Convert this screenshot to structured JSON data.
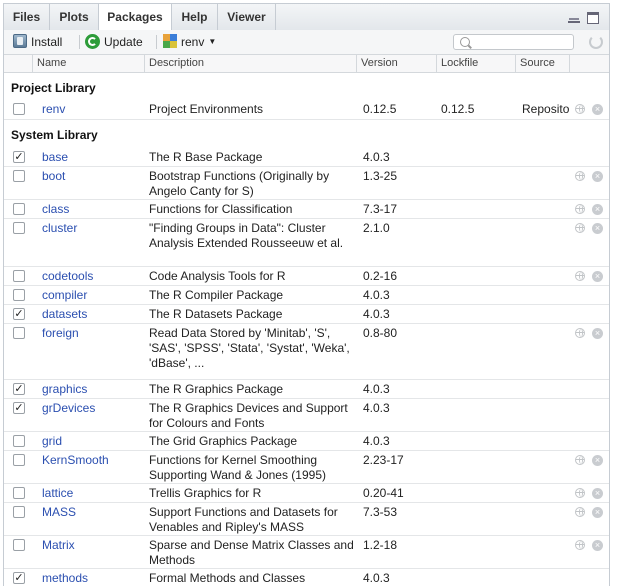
{
  "tabs": [
    "Files",
    "Plots",
    "Packages",
    "Help",
    "Viewer"
  ],
  "toolbar": {
    "install": "Install",
    "update": "Update",
    "renv": "renv",
    "search_placeholder": ""
  },
  "columns": [
    "Name",
    "Description",
    "Version",
    "Lockfile",
    "Source"
  ],
  "sections": {
    "project": "Project Library",
    "system": "System Library"
  },
  "project_packages": [
    {
      "name": "renv",
      "desc": "Project Environments",
      "version": "0.12.5",
      "lockfile": "0.12.5",
      "source": "Repository",
      "checked": false,
      "links": true
    }
  ],
  "system_packages": [
    {
      "name": "base",
      "desc": "The R Base Package",
      "version": "4.0.3",
      "checked": true,
      "links": false
    },
    {
      "name": "boot",
      "desc": "Bootstrap Functions (Originally by Angelo Canty for S)",
      "version": "1.3-25",
      "checked": false,
      "links": true
    },
    {
      "name": "class",
      "desc": "Functions for Classification",
      "version": "7.3-17",
      "checked": false,
      "links": true
    },
    {
      "name": "cluster",
      "desc": "\"Finding Groups in Data\": Cluster Analysis Extended Rousseeuw et al.",
      "version": "2.1.0",
      "checked": false,
      "links": true
    },
    {
      "name": "codetools",
      "desc": "Code Analysis Tools for R",
      "version": "0.2-16",
      "checked": false,
      "links": true
    },
    {
      "name": "compiler",
      "desc": "The R Compiler Package",
      "version": "4.0.3",
      "checked": false,
      "links": false
    },
    {
      "name": "datasets",
      "desc": "The R Datasets Package",
      "version": "4.0.3",
      "checked": true,
      "links": false
    },
    {
      "name": "foreign",
      "desc": "Read Data Stored by 'Minitab', 'S', 'SAS', 'SPSS', 'Stata', 'Systat', 'Weka', 'dBase', ...",
      "version": "0.8-80",
      "checked": false,
      "links": true
    },
    {
      "name": "graphics",
      "desc": "The R Graphics Package",
      "version": "4.0.3",
      "checked": true,
      "links": false
    },
    {
      "name": "grDevices",
      "desc": "The R Graphics Devices and Support for Colours and Fonts",
      "version": "4.0.3",
      "checked": true,
      "links": false
    },
    {
      "name": "grid",
      "desc": "The Grid Graphics Package",
      "version": "4.0.3",
      "checked": false,
      "links": false
    },
    {
      "name": "KernSmooth",
      "desc": "Functions for Kernel Smoothing Supporting Wand & Jones (1995)",
      "version": "2.23-17",
      "checked": false,
      "links": true
    },
    {
      "name": "lattice",
      "desc": "Trellis Graphics for R",
      "version": "0.20-41",
      "checked": false,
      "links": true
    },
    {
      "name": "MASS",
      "desc": "Support Functions and Datasets for Venables and Ripley's MASS",
      "version": "7.3-53",
      "checked": false,
      "links": true
    },
    {
      "name": "Matrix",
      "desc": "Sparse and Dense Matrix Classes and Methods",
      "version": "1.2-18",
      "checked": false,
      "links": true
    },
    {
      "name": "methods",
      "desc": "Formal Methods and Classes",
      "version": "4.0.3",
      "checked": true,
      "links": false
    }
  ]
}
